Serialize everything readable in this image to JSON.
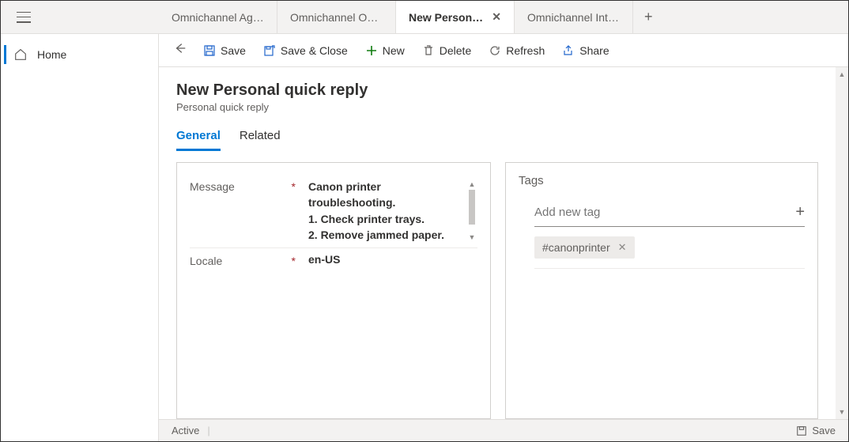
{
  "nav": {
    "home_label": "Home"
  },
  "tabs": [
    {
      "label": "Omnichannel Age..."
    },
    {
      "label": "Omnichannel Ong..."
    },
    {
      "label": "New Personal quick reply",
      "active": true,
      "closable": true
    },
    {
      "label": "Omnichannel Intra..."
    }
  ],
  "commands": {
    "save": "Save",
    "save_close": "Save & Close",
    "new": "New",
    "delete": "Delete",
    "refresh": "Refresh",
    "share": "Share"
  },
  "page": {
    "title": "New Personal quick reply",
    "subtitle": "Personal quick reply"
  },
  "form_tabs": {
    "general": "General",
    "related": "Related"
  },
  "fields": {
    "message_label": "Message",
    "message_value": "Canon printer troubleshooting.\n1. Check printer trays.\n2. Remove jammed paper.",
    "locale_label": "Locale",
    "locale_value": "en-US"
  },
  "tags_panel": {
    "title": "Tags",
    "add_placeholder": "Add new tag",
    "chips": [
      "#canonprinter"
    ]
  },
  "footer": {
    "status": "Active",
    "save": "Save"
  }
}
